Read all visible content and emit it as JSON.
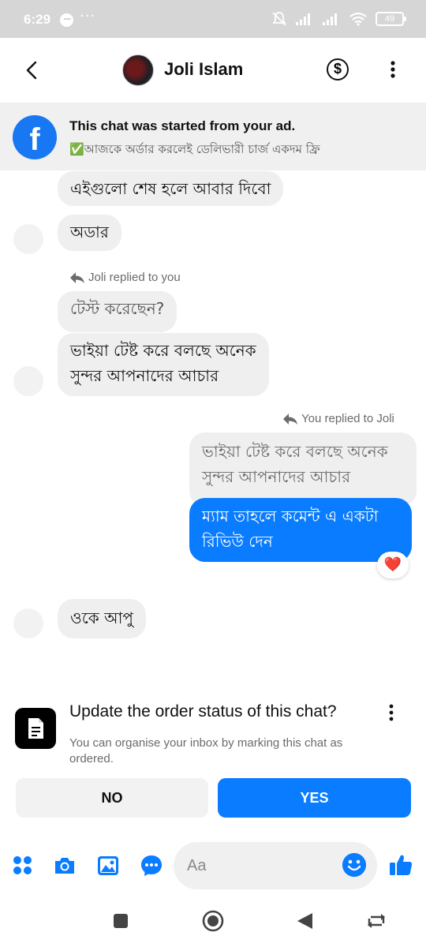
{
  "status_bar": {
    "time": "6:29",
    "dots": "···",
    "battery": "49"
  },
  "header": {
    "contact_name": "Joli Islam",
    "dollar_symbol": "$"
  },
  "ad_banner": {
    "title": "This chat was started from your ad.",
    "subtitle": "✅আজকে অর্ডার করলেই ডেলিভারী চার্জ একদম ফ্রি"
  },
  "messages": {
    "m1": "এইগুলো শেষ হলে আবার দিবো",
    "m2": "অডার",
    "reply_label_1": "Joli replied to you",
    "quote_1": "টেস্ট করেছেন?",
    "m3_line1": "ভাইয়া টেষ্ট করে বলছে অনেক",
    "m3_line2": "সুন্দর  আপনাদের আচার",
    "reply_label_2": "You replied to Joli",
    "quote_2_line1": "ভাইয়া টেষ্ট করে বলছে অনেক",
    "quote_2_line2": "সুন্দর  আপনাদের আচার",
    "m4_line1": "ম্যাম তাহলে কমেন্ট  এ একটা",
    "m4_line2": "রিভিউ দেন",
    "reaction": "❤️",
    "m5": "ওকে আপু"
  },
  "order_card": {
    "title": "Update the order status of this chat?",
    "description": "You can organise your inbox by marking this chat as ordered.",
    "no_label": "NO",
    "yes_label": "YES"
  },
  "composer": {
    "placeholder": "Aa"
  },
  "colors": {
    "accent": "#0a7cff",
    "bubble_gray": "#efefef",
    "banner_bg": "#f0f0f0"
  }
}
